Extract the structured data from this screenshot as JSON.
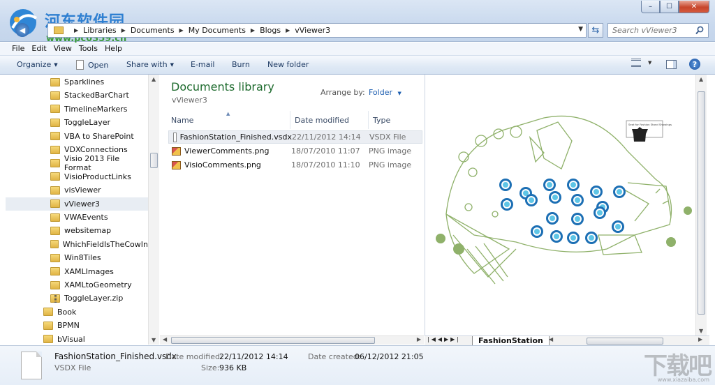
{
  "watermark": {
    "title": "河东软件园",
    "url": "www.pc0359.cn",
    "corner": "下载吧",
    "corner_sub": "www.xiazaiba.com"
  },
  "window_controls": [
    "–",
    "☐",
    "✕"
  ],
  "breadcrumb": [
    "Libraries",
    "Documents",
    "My Documents",
    "Blogs",
    "vViewer3"
  ],
  "search": {
    "placeholder": "Search vViewer3"
  },
  "menu": [
    "File",
    "Edit",
    "View",
    "Tools",
    "Help"
  ],
  "toolbar": {
    "organize": "Organize",
    "open": "Open",
    "share_with": "Share with",
    "email": "E-mail",
    "burn": "Burn",
    "new_folder": "New folder",
    "help": "?"
  },
  "tree": {
    "items": [
      {
        "label": "Sparklines",
        "indent": 2,
        "zip": false,
        "selected": false
      },
      {
        "label": "StackedBarChart",
        "indent": 2,
        "zip": false,
        "selected": false
      },
      {
        "label": "TimelineMarkers",
        "indent": 2,
        "zip": false,
        "selected": false
      },
      {
        "label": "ToggleLayer",
        "indent": 2,
        "zip": false,
        "selected": false
      },
      {
        "label": "VBA to SharePoint",
        "indent": 2,
        "zip": false,
        "selected": false
      },
      {
        "label": "VDXConnections",
        "indent": 2,
        "zip": false,
        "selected": false
      },
      {
        "label": "Visio 2013 File Format",
        "indent": 2,
        "zip": false,
        "selected": false
      },
      {
        "label": "VisioProductLinks",
        "indent": 2,
        "zip": false,
        "selected": false
      },
      {
        "label": "visViewer",
        "indent": 2,
        "zip": false,
        "selected": false
      },
      {
        "label": "vViewer3",
        "indent": 2,
        "zip": false,
        "selected": true
      },
      {
        "label": "VWAEvents",
        "indent": 2,
        "zip": false,
        "selected": false
      },
      {
        "label": "websitemap",
        "indent": 2,
        "zip": false,
        "selected": false
      },
      {
        "label": "WhichFieldIsTheCowIn",
        "indent": 2,
        "zip": false,
        "selected": false
      },
      {
        "label": "Win8Tiles",
        "indent": 2,
        "zip": false,
        "selected": false
      },
      {
        "label": "XAMLImages",
        "indent": 2,
        "zip": false,
        "selected": false
      },
      {
        "label": "XAMLtoGeometry",
        "indent": 2,
        "zip": false,
        "selected": false
      },
      {
        "label": "ToggleLayer.zip",
        "indent": 2,
        "zip": true,
        "selected": false
      },
      {
        "label": "Book",
        "indent": 1,
        "zip": false,
        "selected": false
      },
      {
        "label": "BPMN",
        "indent": 1,
        "zip": false,
        "selected": false
      },
      {
        "label": "bVisual",
        "indent": 1,
        "zip": false,
        "selected": false
      }
    ]
  },
  "library": {
    "title": "Documents library",
    "subtitle": "vViewer3",
    "arrange_label": "Arrange by:",
    "arrange_value": "Folder"
  },
  "columns": [
    "Name",
    "Date modified",
    "Type"
  ],
  "files": [
    {
      "name": "FashionStation_Finished.vsdx",
      "date": "22/11/2012 14:14",
      "type": "VSDX File",
      "icon": "vsdx-file-icon",
      "selected": true
    },
    {
      "name": "ViewerComments.png",
      "date": "18/07/2010 11:07",
      "type": "PNG image",
      "icon": "png-file-icon",
      "selected": false
    },
    {
      "name": "VisioComments.png",
      "date": "18/07/2010 11:10",
      "type": "PNG image",
      "icon": "png-file-icon",
      "selected": false
    }
  ],
  "preview": {
    "page_tab": "FashionStation",
    "callout": "Seat for Fashion Stand Showings"
  },
  "details": {
    "file_name": "FashionStation_Finished.vsdx",
    "file_type": "VSDX File",
    "date_modified_label": "Date modified:",
    "date_modified": "22/11/2012 14:14",
    "size_label": "Size:",
    "size": "936 KB",
    "date_created_label": "Date created:",
    "date_created": "06/12/2012 21:05"
  },
  "colors": {
    "library_title": "#1e6b2e",
    "diagram": "#8fb16a",
    "table_ring": "#1c6fb4",
    "table_center": "#5ec5e6"
  }
}
